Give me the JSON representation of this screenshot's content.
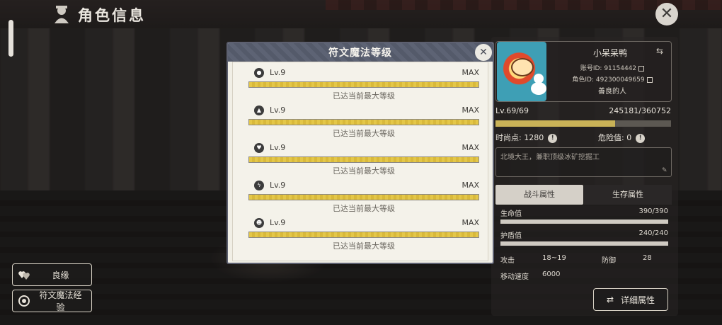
{
  "header": {
    "title": "角色信息"
  },
  "left_buttons": [
    {
      "label": "良缘",
      "icon": "hearts-icon"
    },
    {
      "label": "符文魔法经验",
      "icon": "rune-orb-icon"
    }
  ],
  "profile": {
    "name": "小呆呆鸭",
    "account_id": "账号ID: 91154442",
    "role_id": "角色ID: 492300049659",
    "title": "善良的人",
    "level": "Lv.69/69",
    "exp": "245181/360752",
    "exp_fraction": 0.68,
    "fashion_points": "时尚点: 1280",
    "danger_value": "危险值: 0",
    "signature": "北境大王，兼职顶级冰矿挖掘工"
  },
  "tabs": {
    "battle": "战斗属性",
    "survival": "生存属性"
  },
  "stats": {
    "hp_label": "生命值",
    "hp_value": "390/390",
    "shield_label": "护盾值",
    "shield_value": "240/240",
    "attack_label": "攻击",
    "attack_value": "18~19",
    "defense_label": "防御",
    "defense_value": "28",
    "speed_label": "移动速度",
    "speed_value": "6000"
  },
  "detail_button": "详细属性",
  "modal": {
    "title": "符文魔法等级",
    "runes": [
      {
        "icon": "fire-drop-icon",
        "level": "Lv.9",
        "max": "MAX",
        "note": "已达当前最大等级",
        "progress": 1.0
      },
      {
        "icon": "flame-icon",
        "level": "Lv.9",
        "max": "MAX",
        "note": "已达当前最大等级",
        "progress": 1.0
      },
      {
        "icon": "heart-icon",
        "level": "Lv.9",
        "max": "MAX",
        "note": "已达当前最大等级",
        "progress": 1.0
      },
      {
        "icon": "lightning-icon",
        "level": "Lv.9",
        "max": "MAX",
        "note": "已达当前最大等级",
        "progress": 1.0
      },
      {
        "icon": "skull-icon",
        "level": "Lv.9",
        "max": "MAX",
        "note": "已达当前最大等级",
        "progress": 1.0
      }
    ]
  }
}
